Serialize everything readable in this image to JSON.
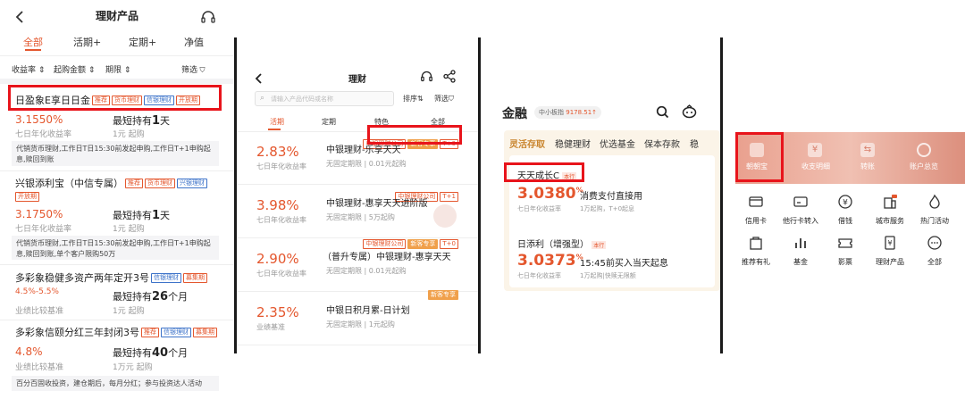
{
  "pane1": {
    "title": "理财产品",
    "tabs": [
      {
        "label": "全部",
        "active": true
      },
      {
        "label": "活期+"
      },
      {
        "label": "定期+"
      },
      {
        "label": "净值"
      }
    ],
    "filters": [
      "收益率 ⇕",
      "起购金额 ⇕",
      "期限 ⇕",
      "筛选"
    ],
    "products": [
      {
        "name": "日盈象E享日日金",
        "tags": [
          "推荐",
          "货币理财",
          "信银理财",
          "开放期"
        ],
        "rate": "3.1550%",
        "rate_label": "七日年化收益率",
        "hold_prefix": "最短持有",
        "hold_num": "1",
        "hold_unit": "天",
        "min": "1元 起购",
        "note": "代销货币理财,工作日T日15:30前发起申购,工作日T+1申购起息,赎回到账"
      },
      {
        "name": "兴银添利宝（中信专属）",
        "tags": [
          "推荐",
          "货币理财",
          "兴银理财",
          "开放期"
        ],
        "rate": "3.1750%",
        "rate_label": "七日年化收益率",
        "hold_prefix": "最短持有",
        "hold_num": "1",
        "hold_unit": "天",
        "min": "1元 起购",
        "note": "代销货币理财,工作日T日15:30前发起申购,工作日T+1申购起息,赎回到账,单个客户限购50万"
      },
      {
        "name": "多彩象稳健多资产两年定开3号",
        "tags": [
          "信银理财",
          "募集期"
        ],
        "rate": "4.5%-5.5%",
        "rate_label": "业绩比较基准",
        "hold_prefix": "最短持有",
        "hold_num": "26",
        "hold_unit": "个月",
        "min": "1元 起购"
      },
      {
        "name": "多彩象信颐分红三年封闭3号",
        "tags": [
          "推荐",
          "信银理财",
          "募集期"
        ],
        "rate": "4.8%",
        "rate_label": "业绩比较基准",
        "hold_prefix": "最短持有",
        "hold_num": "40",
        "hold_unit": "个月",
        "min": "1万元 起购",
        "note": "百分百固收投资，建仓期后，每月分红；参与投资达人活动"
      }
    ]
  },
  "pane2": {
    "title": "理财",
    "search_placeholder": "请输入产品代码或名称",
    "sort_label": "排序",
    "filter_label": "筛选",
    "tabs": [
      {
        "label": "活期",
        "active": true
      },
      {
        "label": "定期"
      },
      {
        "label": "特色"
      },
      {
        "label": "全部"
      }
    ],
    "products": [
      {
        "tags": [
          "中银理财公司",
          "新客专享",
          "T+0"
        ],
        "rate": "2.83%",
        "rate_label": "七日年化收益率",
        "name": "中银理财-乐享天天",
        "sub": "无固定期限 | 0.01元起购"
      },
      {
        "tags": [
          "中银理财公司",
          "T+1"
        ],
        "rate": "3.98%",
        "rate_label": "七日年化收益率",
        "name": "中银理财-惠享天天进阶版",
        "sub": "无固定期限 | 5万起购"
      },
      {
        "tags": [
          "中银理财公司",
          "新客专享",
          "T+0"
        ],
        "rate": "2.90%",
        "rate_label": "七日年化收益率",
        "name": "（普升专属）中银理财-惠享天天",
        "sub": "无固定期限 | 0.01元起购"
      },
      {
        "tags": [
          "新客专享"
        ],
        "rate": "2.35%",
        "rate_label": "业绩基准",
        "name": "中银日积月累-日计划",
        "sub": "无固定期限 | 1元起购"
      }
    ]
  },
  "pane3": {
    "title": "金融",
    "index_label": "中小板指",
    "index_value": "9178.51↑",
    "tabs": [
      {
        "label": "灵活存取",
        "active": true
      },
      {
        "label": "稳健理财"
      },
      {
        "label": "优选基金"
      },
      {
        "label": "保本存款"
      },
      {
        "label": "稳"
      }
    ],
    "products": [
      {
        "name": "天天成长C",
        "badge": "本行",
        "rate": "3.0380",
        "pct": "%",
        "rate_label": "七日年化收益率",
        "desc": "消费支付直接用",
        "sub": "1万起购，T+0起息"
      },
      {
        "name": "日添利（增强型）",
        "badge": "本行",
        "rate": "3.0373",
        "pct": "%",
        "rate_label": "七日年化收益率",
        "desc": "15:45前买入当天起息",
        "sub": "1万起购|快赎无限额"
      }
    ]
  },
  "pane4": {
    "banner_items": [
      "朝朝宝",
      "收支明细",
      "转账",
      "账户总览"
    ],
    "services": [
      "信用卡",
      "他行卡转入",
      "借钱",
      "城市服务",
      "热门活动",
      "推荐有礼",
      "基金",
      "影票",
      "理财产品",
      "全部"
    ]
  }
}
